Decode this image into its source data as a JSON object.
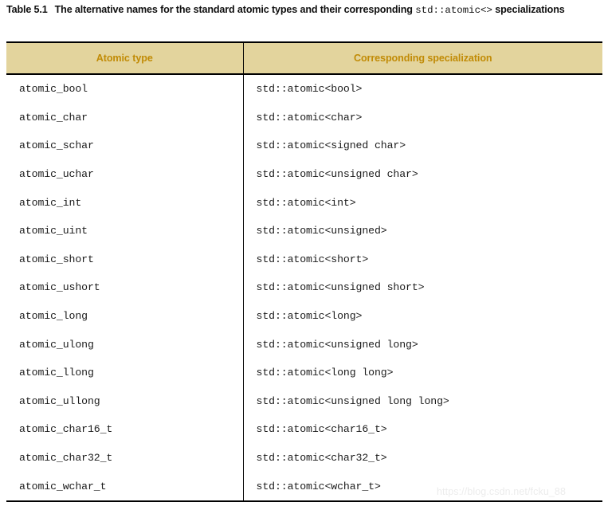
{
  "caption": {
    "label": "Table 5.1",
    "text_before": "The alternative names for the standard atomic types and their corresponding",
    "code": "std::atomic<>",
    "text_after": "specializations"
  },
  "table": {
    "headers": {
      "atomic_type": "Atomic type",
      "specialization": "Corresponding specialization"
    },
    "rows": [
      {
        "atomic_type": "atomic_bool",
        "specialization": "std::atomic<bool>"
      },
      {
        "atomic_type": "atomic_char",
        "specialization": "std::atomic<char>"
      },
      {
        "atomic_type": "atomic_schar",
        "specialization": "std::atomic<signed char>"
      },
      {
        "atomic_type": "atomic_uchar",
        "specialization": "std::atomic<unsigned char>"
      },
      {
        "atomic_type": "atomic_int",
        "specialization": "std::atomic<int>"
      },
      {
        "atomic_type": "atomic_uint",
        "specialization": "std::atomic<unsigned>"
      },
      {
        "atomic_type": "atomic_short",
        "specialization": "std::atomic<short>"
      },
      {
        "atomic_type": "atomic_ushort",
        "specialization": "std::atomic<unsigned short>"
      },
      {
        "atomic_type": "atomic_long",
        "specialization": "std::atomic<long>"
      },
      {
        "atomic_type": "atomic_ulong",
        "specialization": "std::atomic<unsigned long>"
      },
      {
        "atomic_type": "atomic_llong",
        "specialization": "std::atomic<long long>"
      },
      {
        "atomic_type": "atomic_ullong",
        "specialization": "std::atomic<unsigned long long>"
      },
      {
        "atomic_type": "atomic_char16_t",
        "specialization": "std::atomic<char16_t>"
      },
      {
        "atomic_type": "atomic_char32_t",
        "specialization": "std::atomic<char32_t>"
      },
      {
        "atomic_type": "atomic_wchar_t",
        "specialization": "std::atomic<wchar_t>"
      }
    ]
  },
  "watermark": {
    "text": "https://blog.csdn.net/fcku_88"
  },
  "colors": {
    "header_background": "#e3d49d",
    "header_text": "#c18b06",
    "rule": "#000000",
    "body_text": "#1b1b1b",
    "watermark_text": "#ececec",
    "page_background": "#ffffff"
  }
}
